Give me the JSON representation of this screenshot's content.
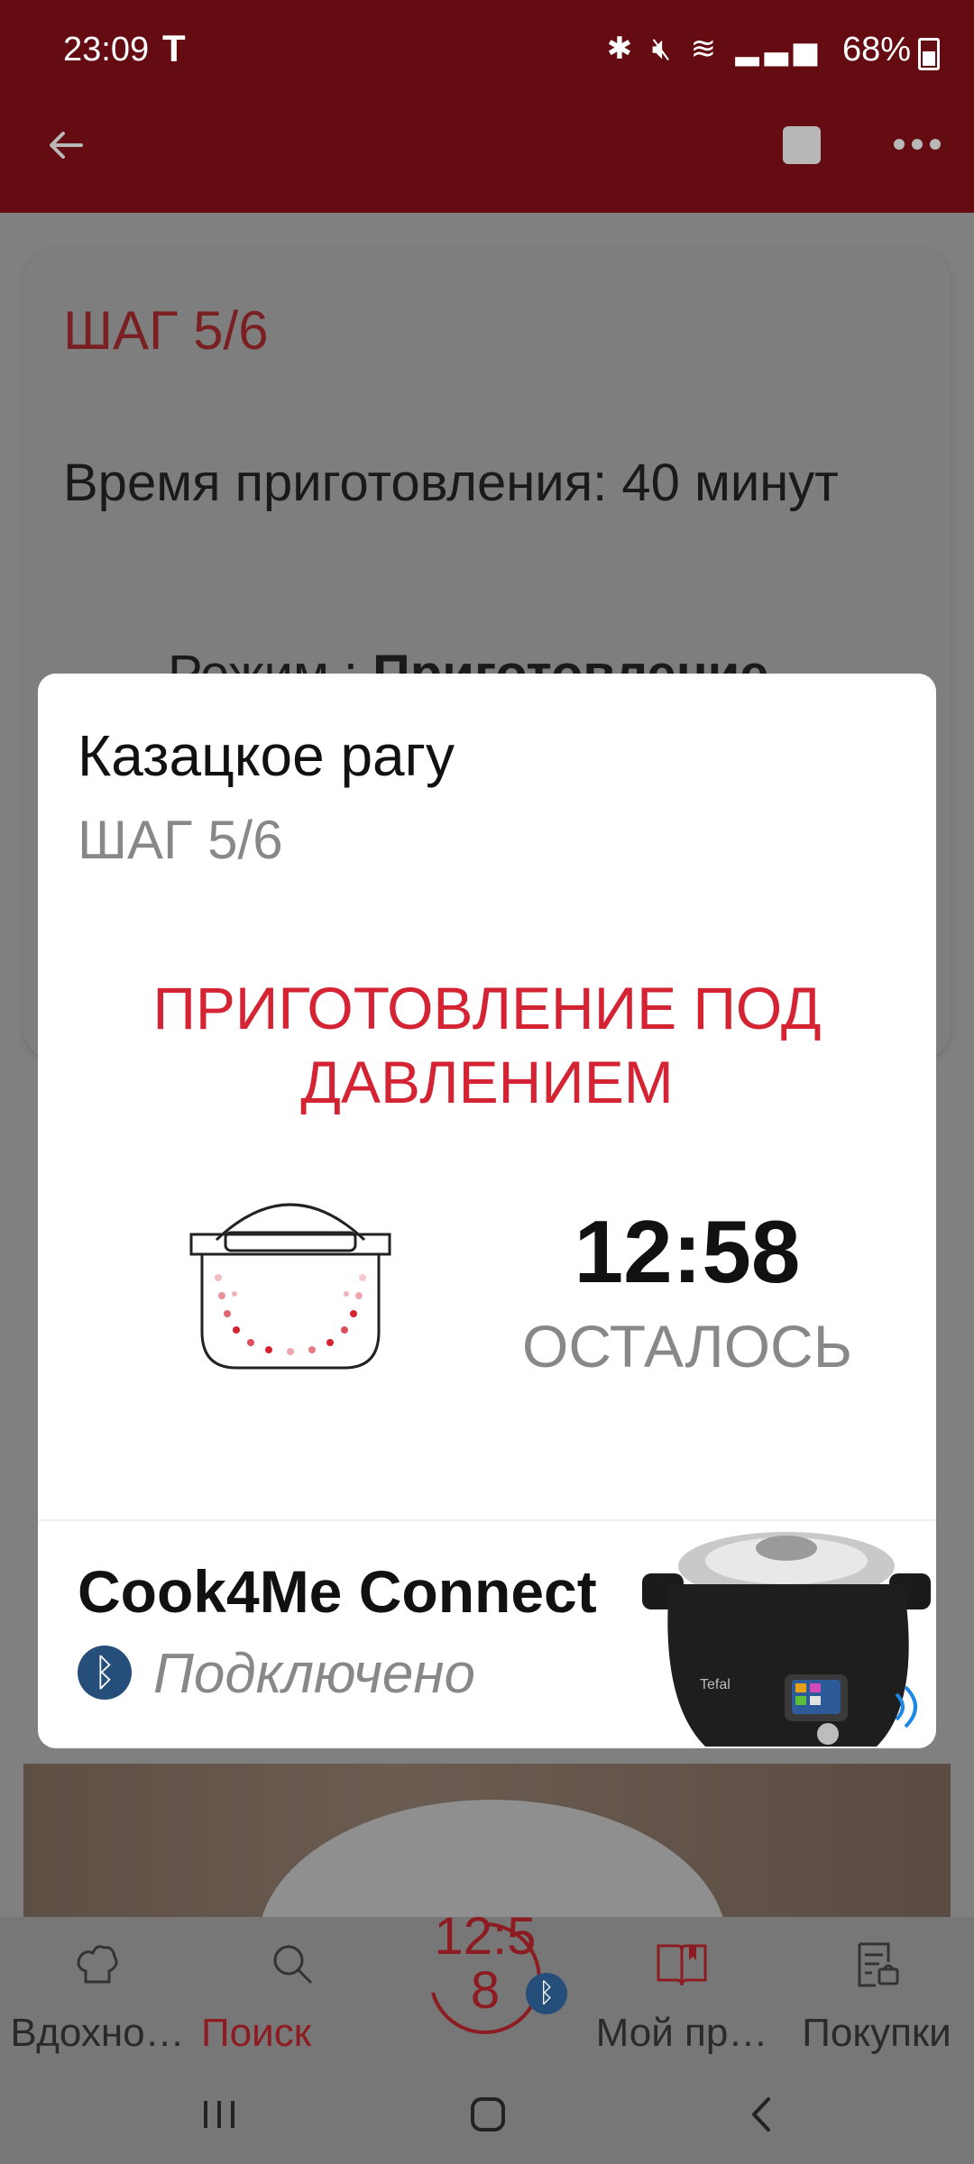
{
  "status_bar": {
    "time": "23:09",
    "carrier_mark": "T",
    "battery": "68%"
  },
  "background_card": {
    "step": "ШАГ 5/6",
    "description": "Время приготовления: 40 минут",
    "mode_prefix": "Режим : ",
    "mode_value": "Приготовление"
  },
  "modal": {
    "recipe_title": "Казацкое рагу",
    "step": "ШАГ 5/6",
    "mode_line1": "ПРИГОТОВЛЕНИЕ ПОД",
    "mode_line2": "ДАВЛЕНИЕМ",
    "timer": "12:58",
    "timer_label": "ОСТАЛОСЬ",
    "device_name": "Cook4Me Connect",
    "connection_status": "Подключено",
    "device_brand": "Tefal"
  },
  "bottom_nav": {
    "items": [
      {
        "label": "Вдохно…",
        "icon": "chef-hat-icon"
      },
      {
        "label": "Поиск",
        "icon": "search-icon",
        "active": true
      },
      {
        "label": "Мой пр…",
        "icon": "book-icon"
      },
      {
        "label": "Покупки",
        "icon": "shopping-list-icon"
      }
    ],
    "timer_line1": "12:5",
    "timer_line2": "8"
  },
  "colors": {
    "header": "#650b12",
    "accent": "#d42333",
    "bluetooth": "#254e7b"
  }
}
